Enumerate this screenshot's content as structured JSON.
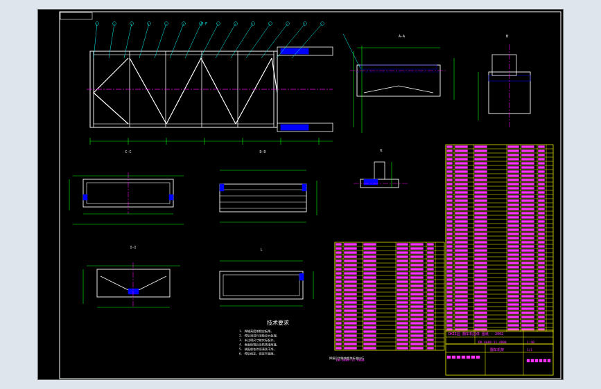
{
  "colors": {
    "background": "#dfe5ec",
    "sheet": "#000000",
    "frame": "#ffffff",
    "part": "#ffffff",
    "dimension": "#00ff00",
    "centerline": "#ff00ff",
    "hidden": "#0000ff",
    "table": "#ffff00",
    "table_text": "#ff33ff",
    "callout": "#00ffff"
  },
  "views": {
    "top": {
      "label": "F-F"
    },
    "section_a": {
      "label": "A-A"
    },
    "section_b": {
      "label": "B"
    },
    "section_c": {
      "label": "C-C"
    },
    "section_d": {
      "label": "D-D"
    },
    "section_e": {
      "label": "I-I"
    },
    "detail_k": {
      "label": "K"
    },
    "section_g": {
      "label": "L"
    }
  },
  "notes": {
    "title": "技术要求",
    "lines": [
      "1. 焊缝高度按相应板厚。",
      "2. 焊后须进行消除应力处理。",
      "3. 未注明尺寸按实际配作。",
      "4. 表面除锈后涂防锈漆两道。",
      "5. 装配前各件须清洗干净。",
      "6. 焊后校正，保证平面度。"
    ],
    "footer": "焊接及涂装按相关标准执行"
  },
  "title_block": {
    "company": "DKII园 翻车机总体 图纸 - 2002",
    "drawing_no": "DK-6688-11-4800",
    "scale": "1:40",
    "sheet": "1/1",
    "part_name": "翻车机架",
    "code": "DK-6688-11-4800"
  }
}
